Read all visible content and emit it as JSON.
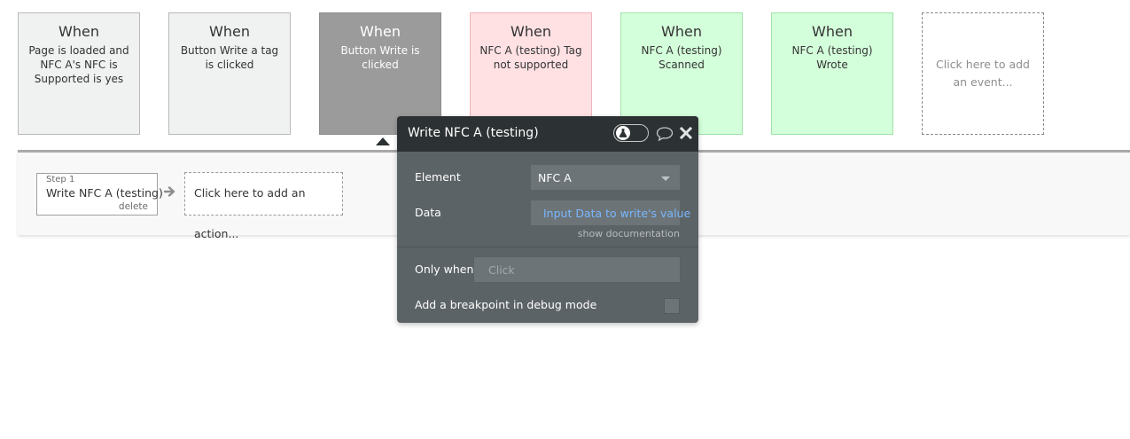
{
  "events": [
    {
      "when": "When",
      "description": "Page is loaded and NFC A's NFC is Supported is yes"
    },
    {
      "when": "When",
      "description": "Button Write a tag is clicked"
    },
    {
      "when": "When",
      "description": "Button Write is clicked"
    },
    {
      "when": "When",
      "description": "NFC A (testing) Tag not supported"
    },
    {
      "when": "When",
      "description": "NFC A (testing) Scanned"
    },
    {
      "when": "When",
      "description": "NFC A (testing) Wrote"
    }
  ],
  "add_event_label": "Click here to add an event...",
  "steps": [
    {
      "step_label": "Step 1",
      "title": "Write NFC A (testing)",
      "delete_label": "delete"
    }
  ],
  "add_action_label": "Click here to add an action...",
  "panel": {
    "title": "Write NFC A (testing)",
    "element_label": "Element",
    "element_value": "NFC A",
    "data_label": "Data",
    "data_value": "Input Data to write's value",
    "show_documentation": "show documentation",
    "only_when_label": "Only when",
    "only_when_placeholder": "Click",
    "breakpoint_label": "Add a breakpoint in debug mode"
  },
  "colors": {
    "event_default": "#f0f1f1",
    "event_selected": "#9b9b9b",
    "event_error": "#ffe1e4",
    "event_success": "#d4ffdb",
    "panel_bg": "#5c6366",
    "panel_header": "#2c3133",
    "link_blue": "#78b7ff"
  },
  "icons": [
    "flask-icon",
    "comment-icon",
    "close-icon",
    "chevron-down-icon",
    "arrow-right-icon"
  ]
}
